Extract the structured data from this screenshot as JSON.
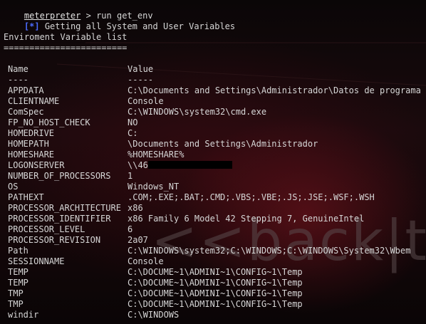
{
  "prompt": {
    "user": "meterpreter",
    "symbol": " > ",
    "command": "run get_env"
  },
  "status": {
    "tag": "[*]",
    "message": " Getting all System and User Variables"
  },
  "heading": {
    "title": "Enviroment Variable list",
    "underline": "========================"
  },
  "table": {
    "headers": {
      "name": "Name",
      "value": "Value"
    },
    "separators": {
      "name": "----",
      "value": "-----"
    },
    "rows": [
      {
        "name": "APPDATA",
        "value": "C:\\Documents and Settings\\Administrador\\Datos de programa"
      },
      {
        "name": "CLIENTNAME",
        "value": "Console"
      },
      {
        "name": "ComSpec",
        "value": "C:\\WINDOWS\\system32\\cmd.exe"
      },
      {
        "name": "FP_NO_HOST_CHECK",
        "value": "NO"
      },
      {
        "name": "HOMEDRIVE",
        "value": "C:"
      },
      {
        "name": "HOMEPATH",
        "value": "\\Documents and Settings\\Administrador"
      },
      {
        "name": "HOMESHARE",
        "value": "%HOMESHARE%"
      },
      {
        "name": "LOGONSERVER",
        "value": "\\\\46"
      },
      {
        "name": "NUMBER_OF_PROCESSORS",
        "value": "1"
      },
      {
        "name": "OS",
        "value": "Windows_NT"
      },
      {
        "name": "PATHEXT",
        "value": ".COM;.EXE;.BAT;.CMD;.VBS;.VBE;.JS;.JSE;.WSF;.WSH"
      },
      {
        "name": "PROCESSOR_ARCHITECTURE",
        "value": "x86"
      },
      {
        "name": "PROCESSOR_IDENTIFIER",
        "value": "x86 Family 6 Model 42 Stepping 7, GenuineIntel"
      },
      {
        "name": "PROCESSOR_LEVEL",
        "value": "6"
      },
      {
        "name": "PROCESSOR_REVISION",
        "value": "2a07"
      },
      {
        "name": "Path",
        "value": "C:\\WINDOWS\\system32;C:\\WINDOWS;C:\\WINDOWS\\System32\\Wbem"
      },
      {
        "name": "SESSIONNAME",
        "value": "Console"
      },
      {
        "name": "TEMP",
        "value": "C:\\DOCUME~1\\ADMINI~1\\CONFIG~1\\Temp"
      },
      {
        "name": "TEMP",
        "value": "C:\\DOCUME~1\\ADMINI~1\\CONFIG~1\\Temp"
      },
      {
        "name": "TMP",
        "value": "C:\\DOCUME~1\\ADMINI~1\\CONFIG~1\\Temp"
      },
      {
        "name": "TMP",
        "value": "C:\\DOCUME~1\\ADMINI~1\\CONFIG~1\\Temp"
      },
      {
        "name": "windir",
        "value": "C:\\WINDOWS"
      }
    ]
  },
  "watermark": {
    "text": "<<back|tr"
  },
  "colors": {
    "background": "#0b0708",
    "text": "#d6d6d6",
    "info_tag": "#4c6cff",
    "redaction": "#000000"
  }
}
